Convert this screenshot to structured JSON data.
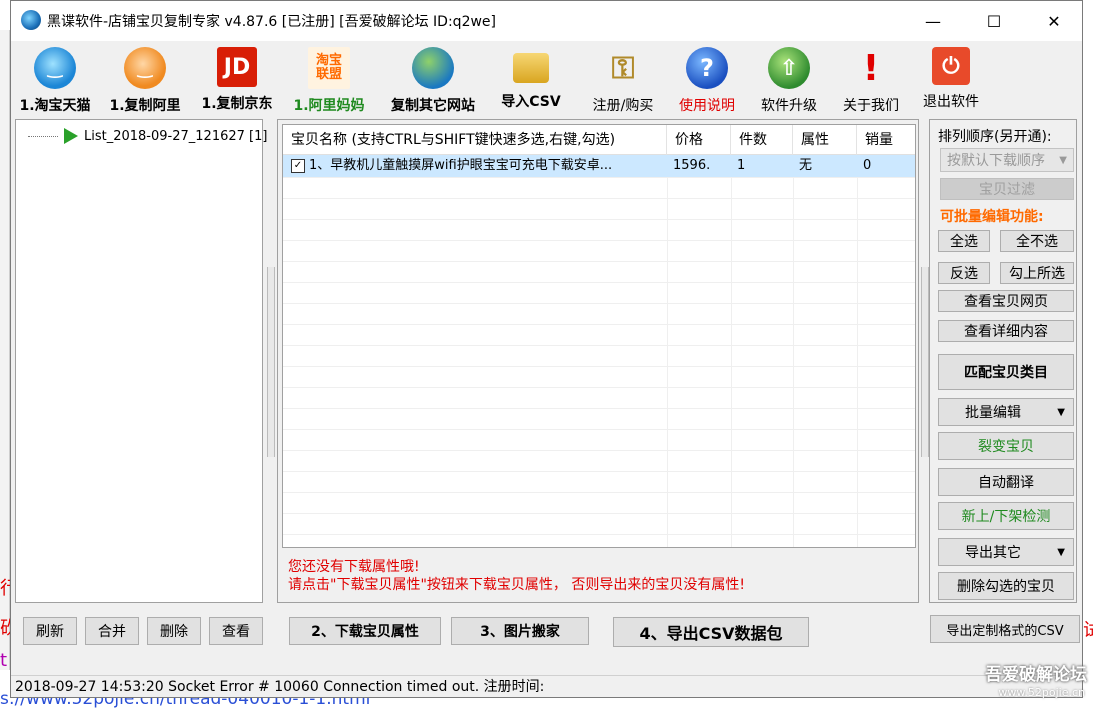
{
  "window": {
    "title": "黑谍软件-店铺宝贝复制专家  v4.87.6 [已注册] [吾爱破解论坛 ID:q2we]",
    "controls": {
      "minimize": "—",
      "maximize": "☐",
      "close": "✕"
    }
  },
  "toolbar": [
    {
      "label": "1.淘宝天猫",
      "icon": "taobao-icon"
    },
    {
      "label": "1.复制阿里",
      "icon": "alibaba-icon"
    },
    {
      "label": "1.复制京东",
      "icon": "jd-icon",
      "glyph": "JD"
    },
    {
      "label": "1.阿里妈妈",
      "icon": "taobao-union-icon",
      "glyph": "淘宝\n联盟"
    },
    {
      "label": "复制其它网站",
      "icon": "globe-icon"
    },
    {
      "label": "导入CSV",
      "icon": "folder-icon"
    },
    {
      "label": "注册/购买",
      "icon": "key-icon"
    },
    {
      "label": "使用说明",
      "icon": "help-icon",
      "glyph": "?"
    },
    {
      "label": "软件升级",
      "icon": "upgrade-icon"
    },
    {
      "label": "关于我们",
      "icon": "exclamation-icon",
      "glyph": "!"
    },
    {
      "label": "退出软件",
      "icon": "power-icon",
      "glyph": "⏻"
    }
  ],
  "colors": {
    "active_green": "#1f8a1f",
    "warning_red": "#e00000",
    "selection": "#cce8ff"
  },
  "tree": {
    "item": "List_2018-09-27_121627 [1]"
  },
  "list": {
    "columns": [
      "宝贝名称 (支持CTRL与SHIFT键快速多选,右键,勾选)",
      "价格",
      "件数",
      "属性",
      "销量"
    ],
    "rows": [
      {
        "check": "✓",
        "name": "1、早教机儿童触摸屏wifi护眼宝宝可充电下载安卓...",
        "price": "1596.",
        "qty": "1",
        "attr": "无",
        "sales": "0"
      }
    ],
    "warning_line1": "您还没有下载属性哦!",
    "warning_line2": "请点击\"下载宝贝属性\"按钮来下载宝贝属性，  否则导出来的宝贝没有属性!"
  },
  "right_panel": {
    "sort_label": "排列顺序(另开通):",
    "sort_value": "按默认下载顺序",
    "filter": "宝贝过滤",
    "batch_label": "可批量编辑功能:",
    "select_all": "全选",
    "select_none": "全不选",
    "invert": "反选",
    "check_selected": "勾上所选",
    "view_page": "查看宝贝网页",
    "view_detail": "查看详细内容",
    "match_category": "匹配宝贝类目",
    "batch_edit": "批量编辑",
    "split": "裂变宝贝",
    "translate": "自动翻译",
    "shelf_check": "新上/下架检测",
    "export_other": "导出其它",
    "delete_checked": "删除勾选的宝贝",
    "export_custom": "导出定制格式的CSV"
  },
  "bottom": {
    "refresh": "刷新",
    "merge": "合并",
    "delete": "删除",
    "view": "查看",
    "download_attr": "2、下载宝贝属性",
    "image_move": "3、图片搬家",
    "export_csv": "4、导出CSV数据包"
  },
  "status": {
    "text": "2018-09-27 14:53:20 Socket Error # 10060  Connection timed out.  注册时间:"
  },
  "background": {
    "left_red": [
      "行",
      "砍",
      "t"
    ],
    "url": "s://www.52pojie.cn/thread-040010-1-1.html",
    "watermark": "吾爱破解论坛",
    "watermark_url": "www.52pojie.cn",
    "right_red": "试"
  }
}
